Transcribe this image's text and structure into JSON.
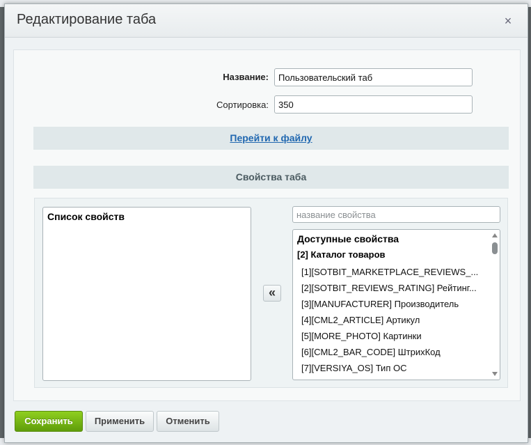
{
  "dialog": {
    "title": "Редактирование таба",
    "close_label": "×"
  },
  "form": {
    "name_label": "Название:",
    "name_value": "Пользовательский таб",
    "sort_label": "Сортировка:",
    "sort_value": "350"
  },
  "file_link": "Перейти к файлу",
  "section_title": "Свойства таба",
  "properties": {
    "list_title": "Список свойств",
    "move_label": "«",
    "search_placeholder": "название свойства",
    "available_title": "Доступные свойства",
    "group_label": "[2] Каталог товаров",
    "items": [
      "[1][SOTBIT_MARKETPLACE_REVIEWS_...",
      "[2][SOTBIT_REVIEWS_RATING] Рейтинг...",
      "[3][MANUFACTURER] Производитель",
      "[4][CML2_ARTICLE] Артикул",
      "[5][MORE_PHOTO] Картинки",
      "[6][CML2_BAR_CODE] ШтрихКод",
      "[7][VERSIYA_OS] Тип ОС"
    ]
  },
  "footer": {
    "save_label": "Сохранить",
    "apply_label": "Применить",
    "cancel_label": "Отменить"
  }
}
